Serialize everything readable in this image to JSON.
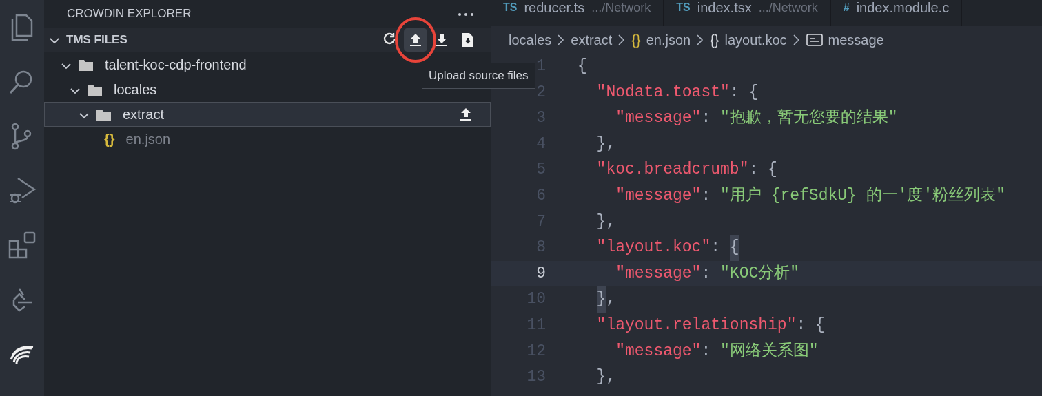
{
  "activity_bar": [
    {
      "kind": "files",
      "selected": false
    },
    {
      "kind": "search",
      "selected": false
    },
    {
      "kind": "source-control",
      "selected": false
    },
    {
      "kind": "run-debug",
      "selected": false
    },
    {
      "kind": "extensions",
      "selected": false
    },
    {
      "kind": "remote",
      "selected": false
    },
    {
      "kind": "crowdin",
      "selected": true
    }
  ],
  "sidebar": {
    "title": "CROWDIN EXPLORER",
    "section": {
      "title": "TMS FILES",
      "expanded": true,
      "actions": [
        {
          "kind": "refresh",
          "hovered": false
        },
        {
          "kind": "upload",
          "hovered": true,
          "circled": true
        },
        {
          "kind": "download",
          "hovered": false
        },
        {
          "kind": "download-file",
          "hovered": false
        }
      ],
      "tooltip": "Upload source files",
      "tree": [
        {
          "kind": "folder",
          "label": "talent-koc-cdp-frontend",
          "expanded": true,
          "selected": false,
          "children": [
            {
              "kind": "folder",
              "label": "locales",
              "expanded": true,
              "selected": false,
              "children": [
                {
                  "kind": "folder",
                  "label": "extract",
                  "expanded": true,
                  "selected": true,
                  "actions": [
                    {
                      "kind": "upload"
                    }
                  ],
                  "children": [
                    {
                      "kind": "file",
                      "icon": "{}",
                      "label": "en.json",
                      "dimmed": true,
                      "selected": false
                    }
                  ]
                }
              ]
            }
          ]
        }
      ]
    }
  },
  "tabs": [
    {
      "icon": "TS",
      "label": "reducer.ts",
      "path": ".../Network",
      "selected": false
    },
    {
      "icon": "TS",
      "label": "index.tsx",
      "path": ".../Network",
      "selected": false
    },
    {
      "icon": "#",
      "label": "index.module.c",
      "selected": false
    }
  ],
  "breadcrumb": [
    {
      "kind": "folder",
      "label": "locales"
    },
    {
      "kind": "folder",
      "label": "extract"
    },
    {
      "kind": "json",
      "icon": "{}",
      "label": "en.json"
    },
    {
      "kind": "object",
      "icon": "{}",
      "label": "layout.koc"
    },
    {
      "kind": "string",
      "label": "message"
    }
  ],
  "editor": {
    "lines": [
      {
        "number": "1",
        "selected": false,
        "tokens": [
          {
            "kind": "punct",
            "text": "{"
          }
        ]
      },
      {
        "number": "2",
        "selected": false,
        "tokens": [
          {
            "kind": "key",
            "text": "  \"Nodata.toast\""
          },
          {
            "kind": "punct",
            "text": ": {"
          }
        ]
      },
      {
        "number": "3",
        "selected": false,
        "tokens": [
          {
            "kind": "key",
            "text": "    \"message\""
          },
          {
            "kind": "punct",
            "text": ": "
          },
          {
            "kind": "string",
            "text": "\"抱歉，暂无您要的结果\""
          }
        ]
      },
      {
        "number": "4",
        "selected": false,
        "tokens": [
          {
            "kind": "punct",
            "text": "  },"
          }
        ]
      },
      {
        "number": "5",
        "selected": false,
        "tokens": [
          {
            "kind": "key",
            "text": "  \"koc.breadcrumb\""
          },
          {
            "kind": "punct",
            "text": ": {"
          }
        ]
      },
      {
        "number": "6",
        "selected": false,
        "tokens": [
          {
            "kind": "key",
            "text": "    \"message\""
          },
          {
            "kind": "punct",
            "text": ": "
          },
          {
            "kind": "string",
            "text": "\"用户 {refSdkU} 的一'度'粉丝列表\""
          }
        ]
      },
      {
        "number": "7",
        "selected": false,
        "tokens": [
          {
            "kind": "punct",
            "text": "  },"
          }
        ]
      },
      {
        "number": "8",
        "selected": false,
        "tokens": [
          {
            "kind": "key",
            "text": "  \"layout.koc\""
          },
          {
            "kind": "punct",
            "text": ": "
          },
          {
            "kind": "punct",
            "text": "{",
            "matched": true
          }
        ]
      },
      {
        "number": "9",
        "selected": true,
        "tokens": [
          {
            "kind": "key",
            "text": "    \"message\""
          },
          {
            "kind": "punct",
            "text": ": "
          },
          {
            "kind": "string",
            "text": "\"KOC分析\""
          }
        ]
      },
      {
        "number": "10",
        "selected": false,
        "tokens": [
          {
            "kind": "punct",
            "text": "  }",
            "matched": true
          },
          {
            "kind": "punct",
            "text": ","
          }
        ]
      },
      {
        "number": "11",
        "selected": false,
        "tokens": [
          {
            "kind": "key",
            "text": "  \"layout.relationship\""
          },
          {
            "kind": "punct",
            "text": ": {"
          }
        ]
      },
      {
        "number": "12",
        "selected": false,
        "tokens": [
          {
            "kind": "key",
            "text": "    \"message\""
          },
          {
            "kind": "punct",
            "text": ": "
          },
          {
            "kind": "string",
            "text": "\"网络关系图\""
          }
        ]
      },
      {
        "number": "13",
        "selected": false,
        "tokens": [
          {
            "kind": "punct",
            "text": "  },"
          }
        ]
      }
    ]
  }
}
